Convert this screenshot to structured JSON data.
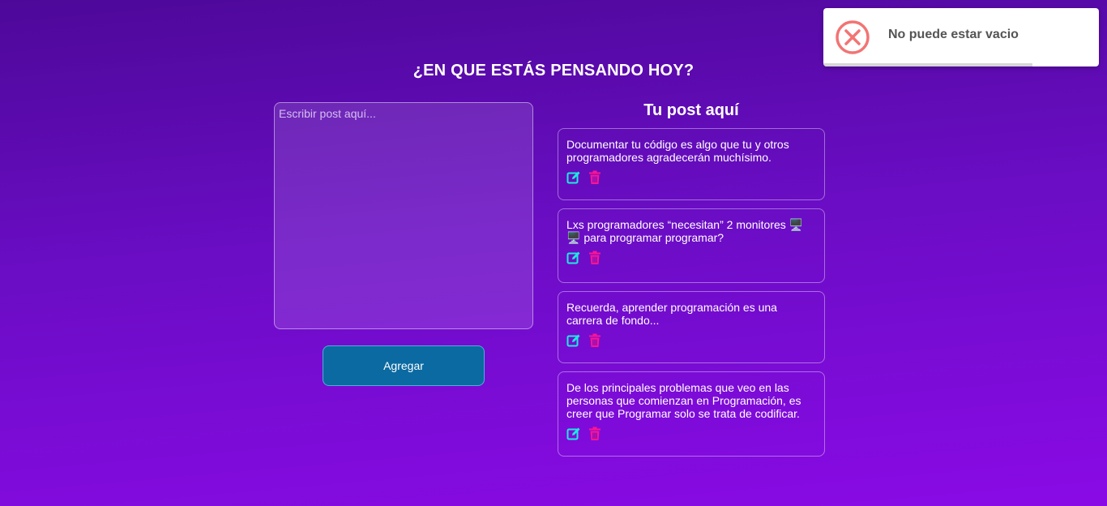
{
  "header": {
    "title": "¿EN QUE ESTÁS PENSANDO HOY?"
  },
  "composer": {
    "placeholder": "Escribir post aquí...",
    "value": "",
    "add_label": "Agregar"
  },
  "posts_section": {
    "title": "Tu post aquí",
    "posts": [
      {
        "text": "Documentar tu código es algo que tu y otros programadores agradecerán muchísimo."
      },
      {
        "text": "Lxs programadores “necesitan” 2 monitores 🖥️🖥️ para programar programar?"
      },
      {
        "text": "Recuerda, aprender programación es una carrera de fondo..."
      },
      {
        "text": "De los principales problemas que veo en las personas que comienzan en Programación, es creer que Programar solo se trata de codificar."
      }
    ],
    "icons": {
      "edit": "edit-icon",
      "delete": "trash-icon"
    }
  },
  "toast": {
    "message": "No puede estar vacio",
    "icon": "error-x-icon",
    "timer_remaining_fraction": 0.76
  },
  "colors": {
    "edit_icon": "#1de9e0",
    "delete_icon": "#ff1493",
    "add_button": "#0a6aa1",
    "error": "#f27474"
  }
}
